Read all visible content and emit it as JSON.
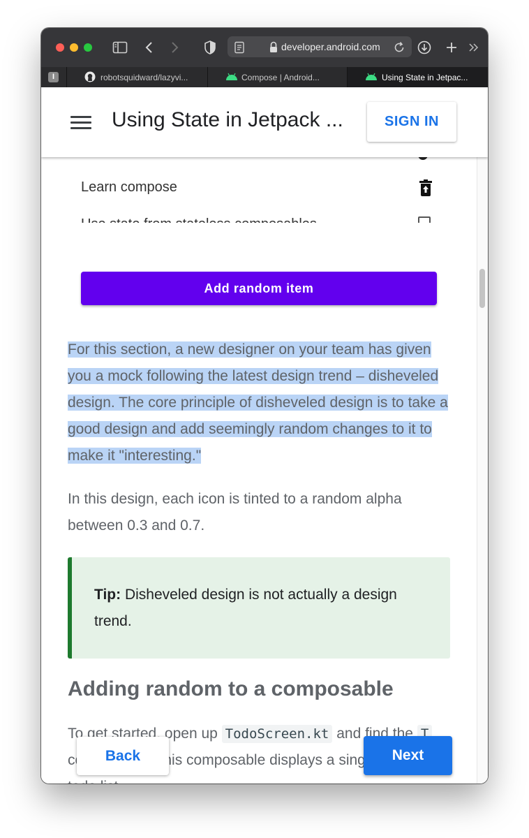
{
  "browser": {
    "url": "developer.android.com",
    "tabs": [
      {
        "label": "robotsquidward/lazyvi..."
      },
      {
        "label": "Compose  |  Android..."
      },
      {
        "label": "Using State in Jetpac..."
      }
    ],
    "pinned_tab_label": "I"
  },
  "header": {
    "title": "Using State in Jetpack ...",
    "sign_in_label": "SIGN IN"
  },
  "mock": {
    "items": [
      {
        "label": "Learn compose",
        "icon": "delete-icon"
      },
      {
        "label": "Use state from stateless composables",
        "icon": "checkbox-icon"
      }
    ],
    "button_label": "Add random item"
  },
  "content": {
    "highlighted_paragraph": "For this section, a new designer on your team has given you a mock following the latest design trend – disheveled design. The core principle of disheveled design is to take a good design and add seemingly random changes to it to make it \"interesting.\"",
    "paragraph2": "In this design, each icon is tinted to a random alpha between 0.3 and 0.7.",
    "tip_label": "Tip:",
    "tip_text": " Disheveled design is not actually a design trend.",
    "section_heading": "Adding random to a composable",
    "bottom_text_1": "To get started, open up ",
    "bottom_code_1": "TodoScreen.kt",
    "bottom_text_2": " and find the ",
    "bottom_code_2": "T",
    "bottom_text_3": " composable. This composable displays a single row in the todo list."
  },
  "nav": {
    "back_label": "Back",
    "next_label": "Next"
  },
  "colors": {
    "accent": "#1a73e8",
    "mock_button": "#6200ee",
    "selection": "#bad4f6",
    "tip_background": "#e5f2e7",
    "tip_border": "#1e7a2e"
  }
}
